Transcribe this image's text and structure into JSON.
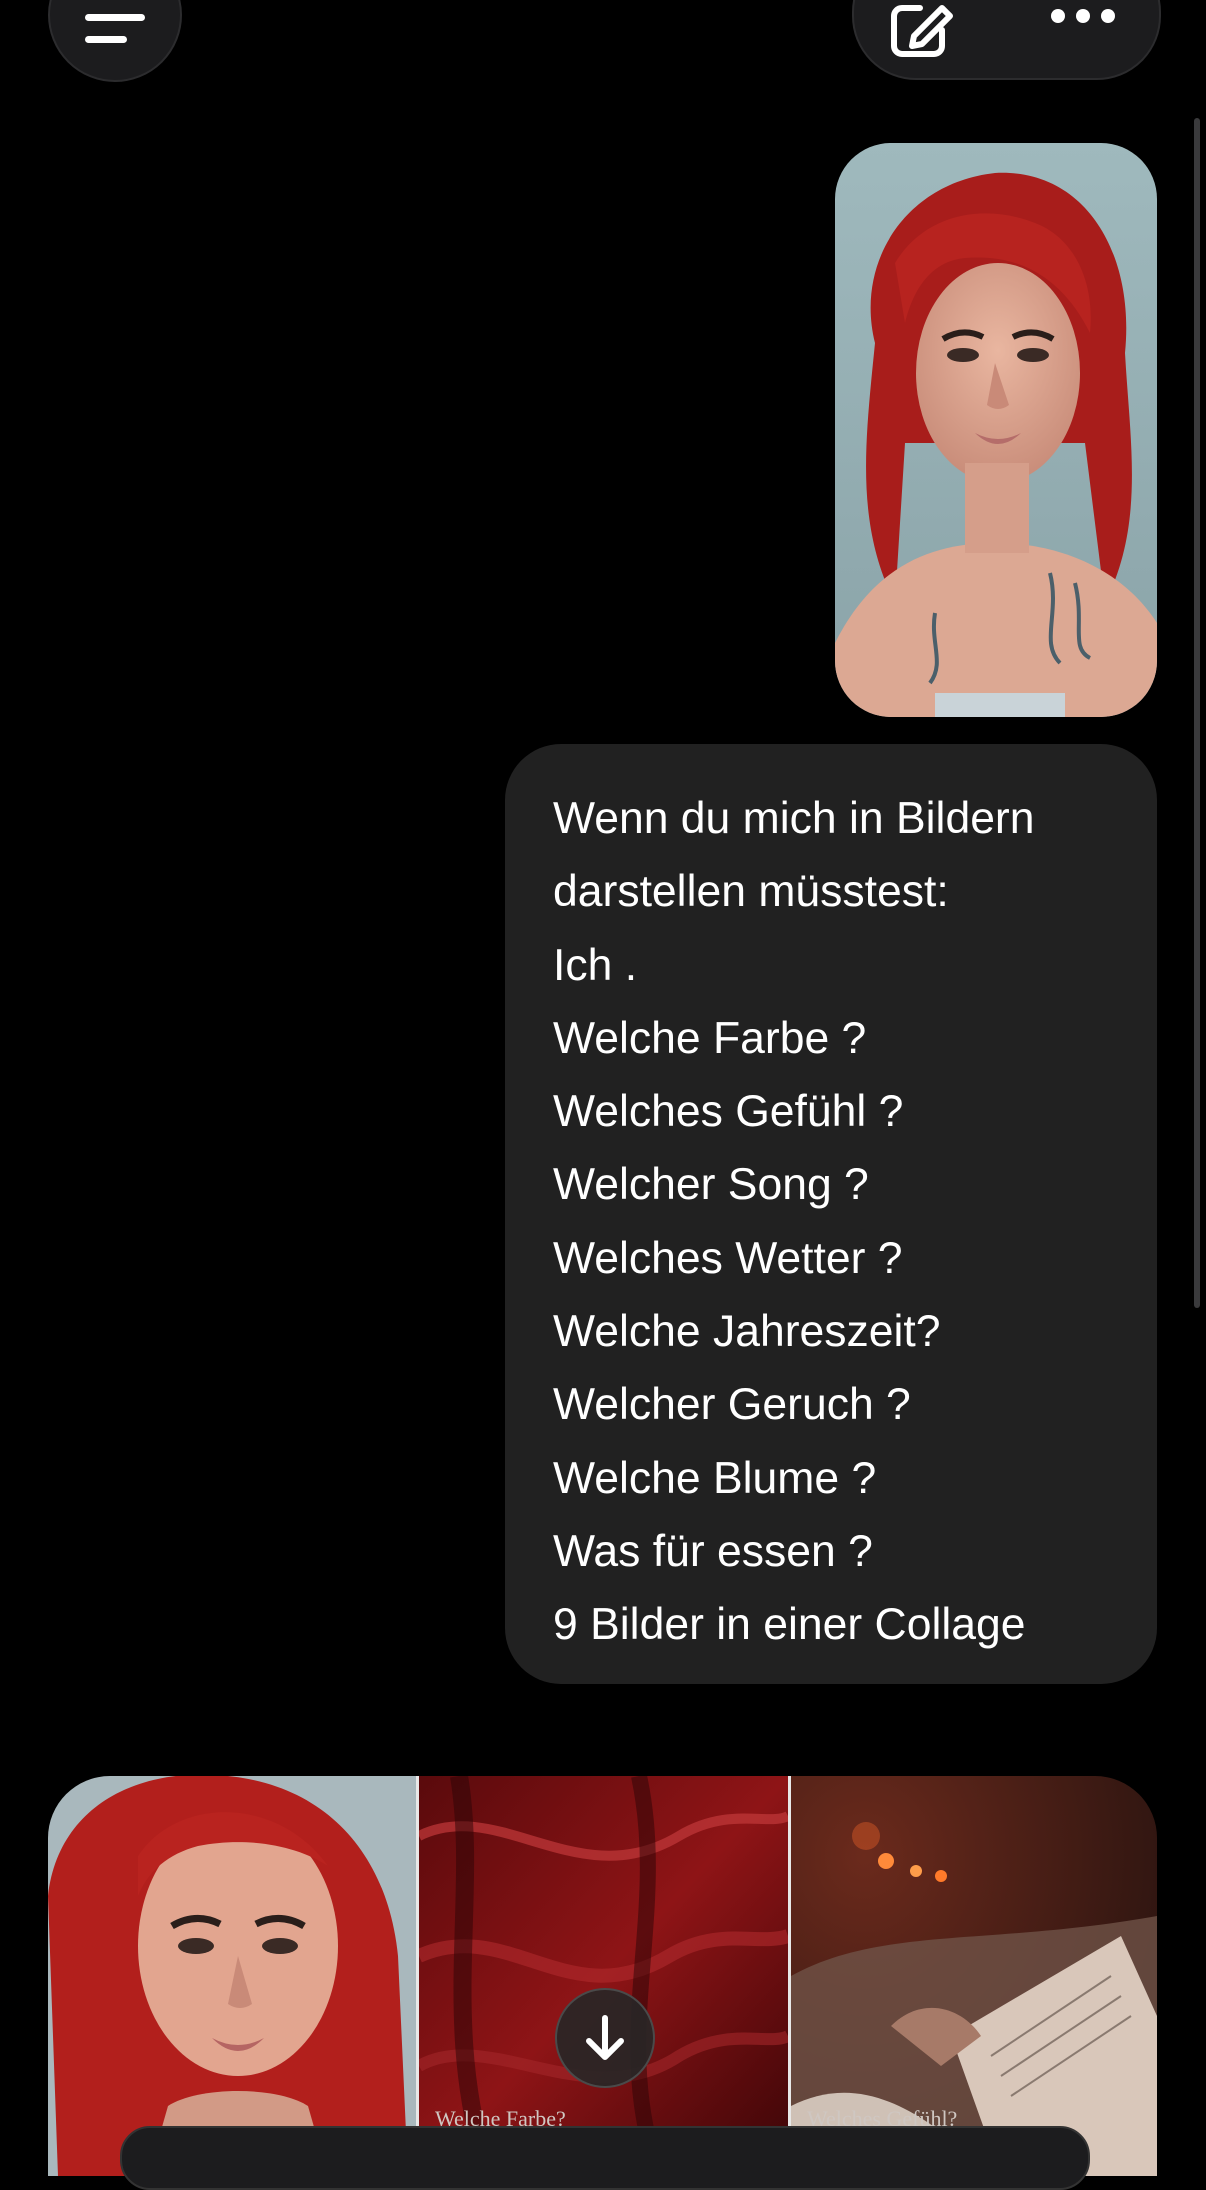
{
  "header": {
    "menu_icon": "menu-icon",
    "edit_icon": "edit-icon",
    "more_icon": "more-icon"
  },
  "message": {
    "photo": "user-photo",
    "lines": [
      "Wenn du mich in Bildern",
      "darstellen müsstest:",
      "Ich .",
      "Welche Farbe ?",
      "Welches Gefühl ?",
      "Welcher Song ?",
      "Welches Wetter ?",
      "Welche Jahreszeit?",
      "Welcher Geruch ?",
      "Welche Blume ?",
      "Was für essen ?",
      "9 Bilder in einer Collage"
    ]
  },
  "collage": {
    "captions": [
      "",
      "Welche Farbe?",
      "Welches Gefühl?"
    ]
  },
  "scroll_down_icon": "arrow-down-icon",
  "colors": {
    "background": "#000000",
    "bubble": "#212121",
    "hair": "#b3211c",
    "button": "#1c1c1e"
  }
}
